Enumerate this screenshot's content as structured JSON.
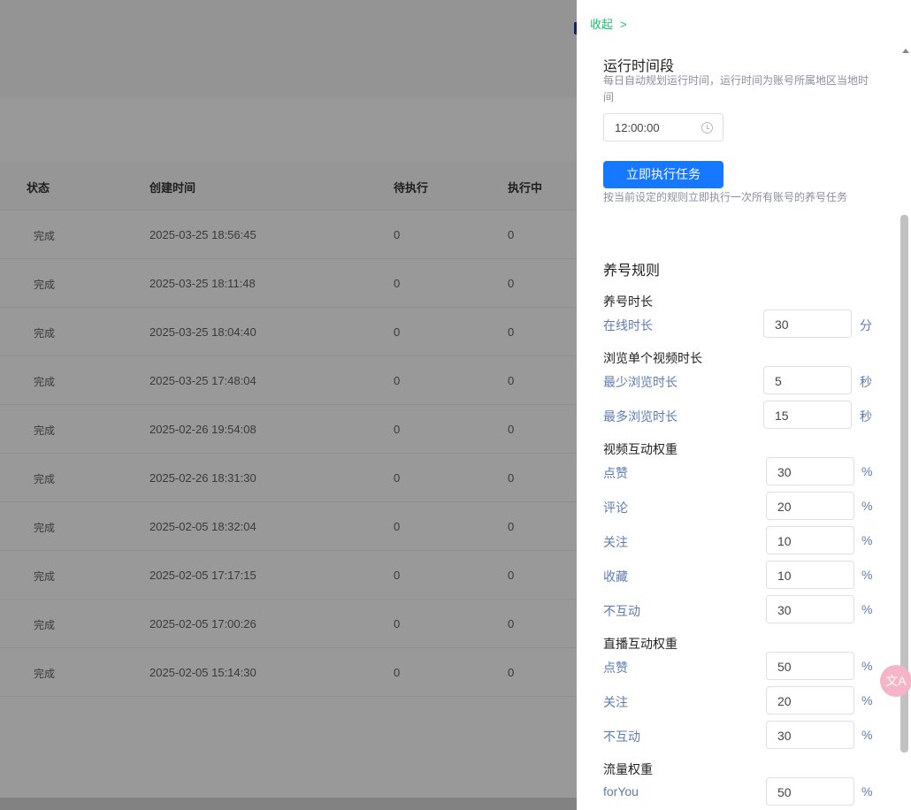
{
  "table": {
    "headers": {
      "status": "状态",
      "created": "创建时间",
      "pending": "待执行",
      "running": "执行中"
    },
    "rows": [
      {
        "status": "完成",
        "created": "2025-03-25 18:56:45",
        "pending": "0",
        "running": "0"
      },
      {
        "status": "完成",
        "created": "2025-03-25 18:11:48",
        "pending": "0",
        "running": "0"
      },
      {
        "status": "完成",
        "created": "2025-03-25 18:04:40",
        "pending": "0",
        "running": "0"
      },
      {
        "status": "完成",
        "created": "2025-03-25 17:48:04",
        "pending": "0",
        "running": "0"
      },
      {
        "status": "完成",
        "created": "2025-02-26 19:54:08",
        "pending": "0",
        "running": "0"
      },
      {
        "status": "完成",
        "created": "2025-02-26 18:31:30",
        "pending": "0",
        "running": "0"
      },
      {
        "status": "完成",
        "created": "2025-02-05 18:32:04",
        "pending": "0",
        "running": "0"
      },
      {
        "status": "完成",
        "created": "2025-02-05 17:17:15",
        "pending": "0",
        "running": "0"
      },
      {
        "status": "完成",
        "created": "2025-02-05 17:00:26",
        "pending": "0",
        "running": "0"
      },
      {
        "status": "完成",
        "created": "2025-02-05 15:14:30",
        "pending": "0",
        "running": "0"
      }
    ]
  },
  "drawer": {
    "collapse_label": "收起",
    "collapse_chevron": ">",
    "schedule": {
      "title": "运行时间段",
      "hint": "每日自动规划运行时间，运行时间为账号所属地区当地时间",
      "time_value": "12:00:00"
    },
    "run_button": "立即执行任务",
    "run_hint": "按当前设定的规则立即执行一次所有账号的养号任务",
    "rules": {
      "title": "养号规则",
      "duration": {
        "title": "养号时长",
        "online_label": "在线时长",
        "online_value": "30",
        "online_unit": "分"
      },
      "browse": {
        "title": "浏览单个视频时长",
        "min_label": "最少浏览时长",
        "min_value": "5",
        "min_unit": "秒",
        "max_label": "最多浏览时长",
        "max_value": "15",
        "max_unit": "秒"
      },
      "video": {
        "title": "视频互动权重",
        "like_label": "点赞",
        "like_value": "30",
        "comment_label": "评论",
        "comment_value": "20",
        "follow_label": "关注",
        "follow_value": "10",
        "favorite_label": "收藏",
        "favorite_value": "10",
        "none_label": "不互动",
        "none_value": "30",
        "unit": "%"
      },
      "live": {
        "title": "直播互动权重",
        "like_label": "点赞",
        "like_value": "50",
        "follow_label": "关注",
        "follow_value": "20",
        "none_label": "不互动",
        "none_value": "30",
        "unit": "%"
      },
      "traffic": {
        "title": "流量权重",
        "foryou_label": "forYou",
        "foryou_value": "50",
        "unit": "%"
      }
    }
  },
  "translate_fab": "文A"
}
